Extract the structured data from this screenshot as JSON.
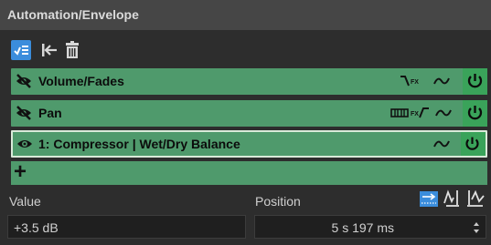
{
  "panel": {
    "title": "Automation/Envelope"
  },
  "toolbar": {
    "buttons": [
      {
        "name": "envelope-list-icon",
        "active": true
      },
      {
        "name": "collapse-left-icon",
        "active": false
      },
      {
        "name": "trash-icon",
        "active": false
      }
    ]
  },
  "envelopes": [
    {
      "label": "Volume/Fades",
      "visible": false,
      "icons": [
        "fx-curve-icon",
        "curve-icon"
      ]
    },
    {
      "label": "Pan",
      "visible": false,
      "icons": [
        "pan-scale-icon",
        "fx-curve-icon",
        "curve-icon"
      ]
    },
    {
      "label": "1: Compressor | Wet/Dry Balance",
      "visible": true,
      "selected": true,
      "icons": [
        "curve-icon"
      ]
    }
  ],
  "add_row": {
    "label": "+"
  },
  "value": {
    "label": "Value",
    "text": "+3.5 dB"
  },
  "position": {
    "label": "Position",
    "text": "5 s 197 ms"
  },
  "colors": {
    "accent": "#4f9a6c",
    "power": "#3aa35a",
    "toolbar_active": "#3b8ddc"
  }
}
